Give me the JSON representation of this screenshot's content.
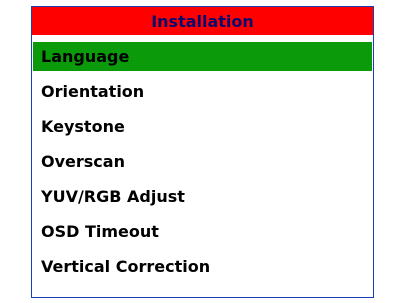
{
  "menu": {
    "title": "Installation",
    "selected_color": "#0a9a0a",
    "title_bar_color": "#ff0000",
    "items": [
      {
        "label": "Language",
        "selected": true
      },
      {
        "label": "Orientation",
        "selected": false
      },
      {
        "label": "Keystone",
        "selected": false
      },
      {
        "label": "Overscan",
        "selected": false
      },
      {
        "label": "YUV/RGB Adjust",
        "selected": false
      },
      {
        "label": "OSD Timeout",
        "selected": false
      },
      {
        "label": "Vertical Correction",
        "selected": false
      }
    ]
  }
}
